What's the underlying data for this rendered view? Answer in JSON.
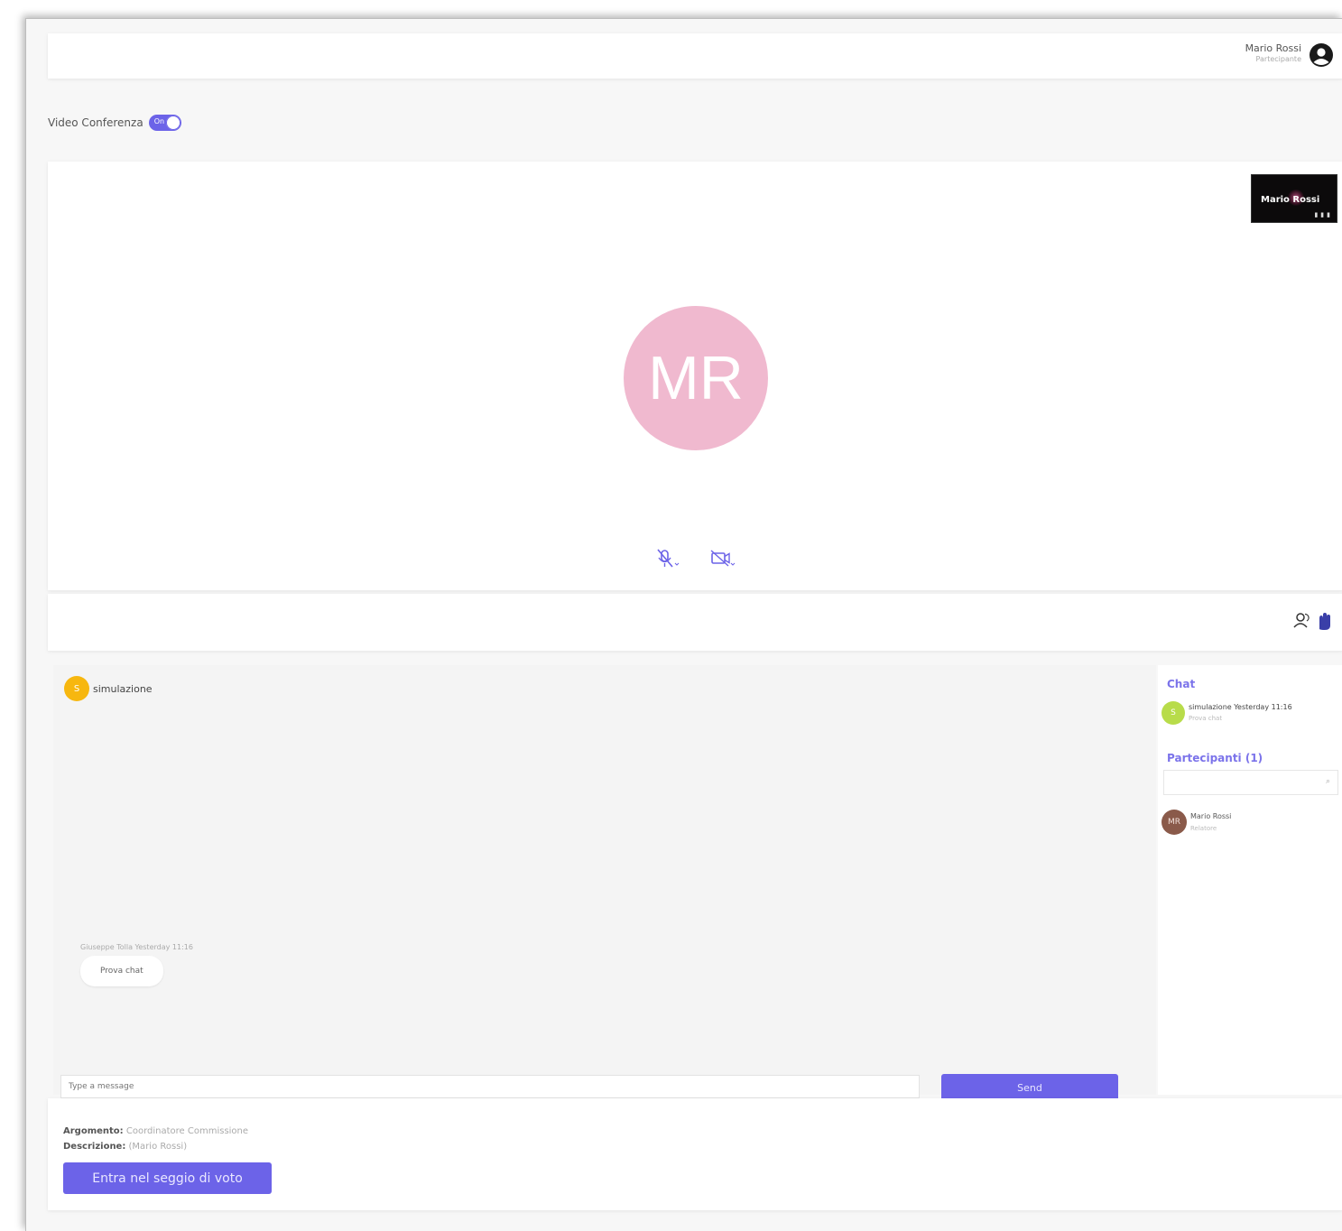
{
  "header": {
    "user_name": "Mario Rossi",
    "user_role": "Partecipante",
    "user_icon": "user-circle-icon"
  },
  "video_conference": {
    "label": "Video Conferenza",
    "toggle_text": "On",
    "enabled": true
  },
  "video": {
    "thumbnail_name": "Mario Rossi",
    "avatar_initials": "MR",
    "avatar_color": "#f0b9cf",
    "mic_icon": "mic-muted-icon",
    "camera_icon": "camera-off-icon"
  },
  "toolbar": {
    "icons": [
      "participants-icon",
      "raise-hand-icon"
    ]
  },
  "chat": {
    "room_initial": "S",
    "room_name": "simulazione",
    "message": {
      "meta": "Giuseppe Tolla Yesterday 11:16",
      "text": "Prova chat"
    },
    "input_placeholder": "Type a message",
    "send_label": "Send"
  },
  "side_panel": {
    "chat_title": "Chat",
    "chat_item": {
      "initial": "S",
      "title": "simulazione Yesterday 11:16",
      "subtitle": "Prova chat"
    },
    "participants_title": "Partecipanti (1)",
    "participant": {
      "initials": "MR",
      "name": "Mario Rossi",
      "status": "Relatore"
    }
  },
  "info": {
    "argomento_label": "Argomento:",
    "argomento_value": "Coordinatore Commissione",
    "descrizione_label": "Descrizione:",
    "descrizione_value": "(Mario Rossi)",
    "enter_button": "Entra nel seggio di voto"
  },
  "colors": {
    "accent": "#6c63e8",
    "room_avatar": "#f7b70f",
    "chat_avatar": "#b8dc4a"
  }
}
